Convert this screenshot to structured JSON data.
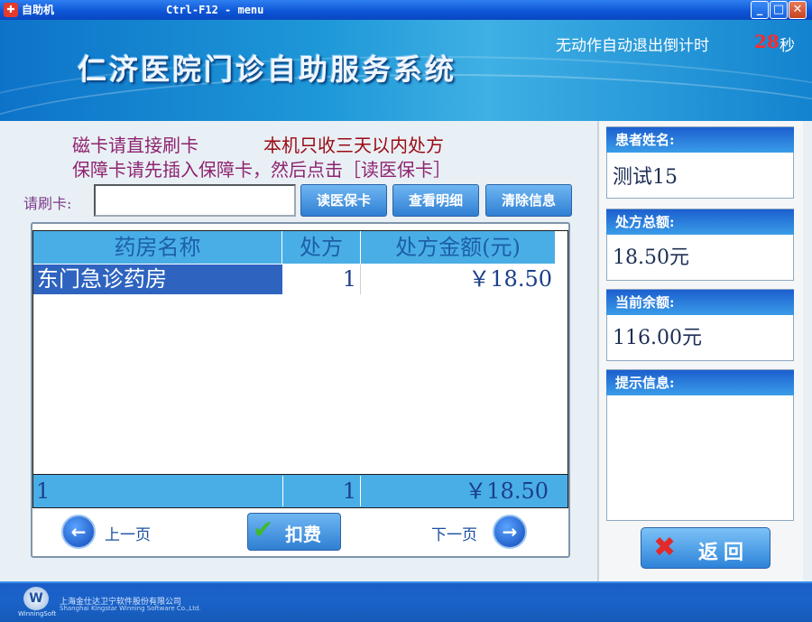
{
  "window": {
    "title": "自助机",
    "shortcut": "Ctrl-F12 - menu",
    "controls": {
      "minimize": "_",
      "maximize": "□",
      "close": "✕"
    }
  },
  "banner": {
    "title": "仁济医院门诊自助服务系统",
    "countdown_label": "无动作自动退出倒计时",
    "countdown_value": "28",
    "countdown_unit": "秒"
  },
  "notices": {
    "swipe": "磁卡请直接刷卡",
    "limit": "本机只收三天以内处方",
    "insurance": "保障卡请先插入保障卡，然后点击［读医保卡］"
  },
  "card": {
    "label": "请刷卡:",
    "value": ""
  },
  "buttons": {
    "read_card": "读医保卡",
    "view_detail": "查看明细",
    "clear_info": "清除信息",
    "charge": "扣费",
    "return": "返回",
    "prev_page": "上一页",
    "next_page": "下一页"
  },
  "table": {
    "headers": [
      "药房名称",
      "处方",
      "处方金额(元)"
    ],
    "rows": [
      {
        "pharmacy": "东门急诊药房",
        "count": "1",
        "amount": "￥18.50"
      }
    ],
    "footer": {
      "row_count": "1",
      "total_count": "1",
      "total_amount": "￥18.50"
    }
  },
  "patient": {
    "name_label": "患者姓名:",
    "name": "测试15",
    "total_label": "处方总额:",
    "total": "18.50元",
    "balance_label": "当前余额:",
    "balance": "116.00元",
    "tips_label": "提示信息:",
    "tips": ""
  },
  "footer": {
    "logo": "WinningSoft",
    "company": "上海金仕达卫宁软件股份有限公司",
    "company_en": "Shanghai Kingstar Winning Software Co.,Ltd."
  },
  "icons": {
    "app": "app-icon",
    "prev": "arrow-left-circle-icon",
    "next": "arrow-right-circle-icon",
    "charge": "checkmark-icon",
    "return": "x-icon"
  },
  "colors": {
    "titlebar": "#0c54d6",
    "accent": "#4aaee6",
    "selected_row": "#2e64c0",
    "countdown": "#ff2a2a",
    "notice_purple": "#8e2370",
    "notice_red": "#9b0a14"
  }
}
